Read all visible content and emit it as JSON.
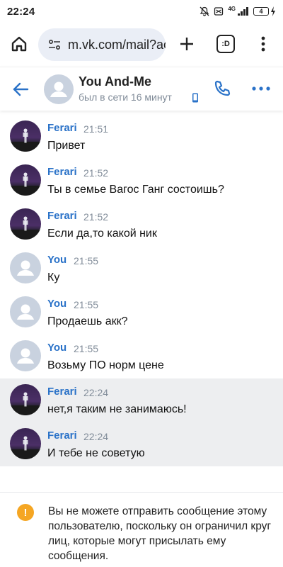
{
  "status_bar": {
    "time": "22:24",
    "network": "4G",
    "battery": "4"
  },
  "browser": {
    "url": "m.vk.com/mail?ac",
    "tabs_label": ":D"
  },
  "chat_header": {
    "title": "You And-Me",
    "status": "был в сети 16 минут"
  },
  "messages": [
    {
      "sender": "Ferari",
      "time": "21:51",
      "text": "Привет",
      "avatar": "ferari-avatar",
      "unread": false
    },
    {
      "sender": "Ferari",
      "time": "21:52",
      "text": "Ты в семье Вагос Ганг состоишь?",
      "avatar": "ferari-avatar",
      "unread": false
    },
    {
      "sender": "Ferari",
      "time": "21:52",
      "text": "Если да,то какой ник",
      "avatar": "ferari-avatar",
      "unread": false
    },
    {
      "sender": "You",
      "time": "21:55",
      "text": "Ку",
      "avatar": "default-user-avatar",
      "unread": false
    },
    {
      "sender": "You",
      "time": "21:55",
      "text": "Продаешь акк?",
      "avatar": "default-user-avatar",
      "unread": false
    },
    {
      "sender": "You",
      "time": "21:55",
      "text": "Возьму ПО норм цене",
      "avatar": "default-user-avatar",
      "unread": false
    },
    {
      "sender": "Ferari",
      "time": "22:24",
      "text": "нет,я таким не занимаюсь!",
      "avatar": "ferari-avatar",
      "unread": true
    },
    {
      "sender": "Ferari",
      "time": "22:24",
      "text": "И тебе не советую",
      "avatar": "ferari-avatar",
      "unread": true
    }
  ],
  "notice": {
    "icon": "warning-icon",
    "text": "Вы не можете отправить сообщение этому пользователю, поскольку он ограничил круг лиц, которые могут присылать ему сообщения."
  },
  "colors": {
    "accent": "#2a72c8",
    "muted": "#818c99",
    "unread_bg": "#edeef0",
    "warning": "#f5a623"
  }
}
